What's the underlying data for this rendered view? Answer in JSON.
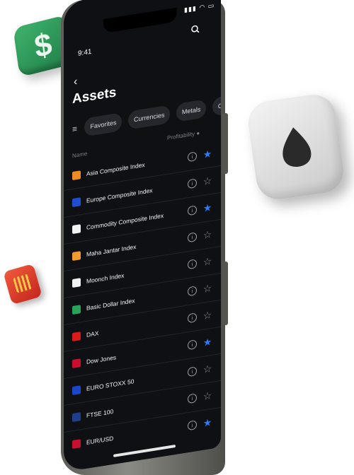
{
  "status_bar": {
    "time": "9:41"
  },
  "header": {
    "title": "Assets"
  },
  "filters": [
    "Favorites",
    "Currencies",
    "Metals",
    "Commodi"
  ],
  "columns": {
    "name": "Name",
    "profitability": "Profitability"
  },
  "assets": [
    {
      "name": "Asia Composite Index",
      "flag_color": "#f08a24",
      "favorite": true
    },
    {
      "name": "Europe Composite Index",
      "flag_color": "#1f4fd0",
      "favorite": false
    },
    {
      "name": "Commodity Composite Index",
      "flag_color": "#f2f2f2",
      "favorite": true
    },
    {
      "name": "Maha Jantar Index",
      "flag_color": "#f39a2e",
      "favorite": false
    },
    {
      "name": "Moonch Index",
      "flag_color": "#f2f2f2",
      "favorite": false
    },
    {
      "name": "Basic Dollar Index",
      "flag_color": "#29a35a",
      "favorite": false
    },
    {
      "name": "DAX",
      "flag_color": "#dd1a1a",
      "favorite": false
    },
    {
      "name": "Dow Jones",
      "flag_color": "#c8102e",
      "favorite": true
    },
    {
      "name": "EURO STOXX 50",
      "flag_color": "#1c46c8",
      "favorite": false
    },
    {
      "name": "FTSE 100",
      "flag_color": "#1f3f8c",
      "favorite": false
    },
    {
      "name": "EUR/USD",
      "flag_color": "#c8102e",
      "favorite": true
    }
  ],
  "colors": {
    "accent": "#2f7bf5",
    "background": "#0f1013"
  },
  "icons": {
    "back": "back-chevron-icon",
    "search": "search-icon",
    "filter": "filter-icon"
  }
}
